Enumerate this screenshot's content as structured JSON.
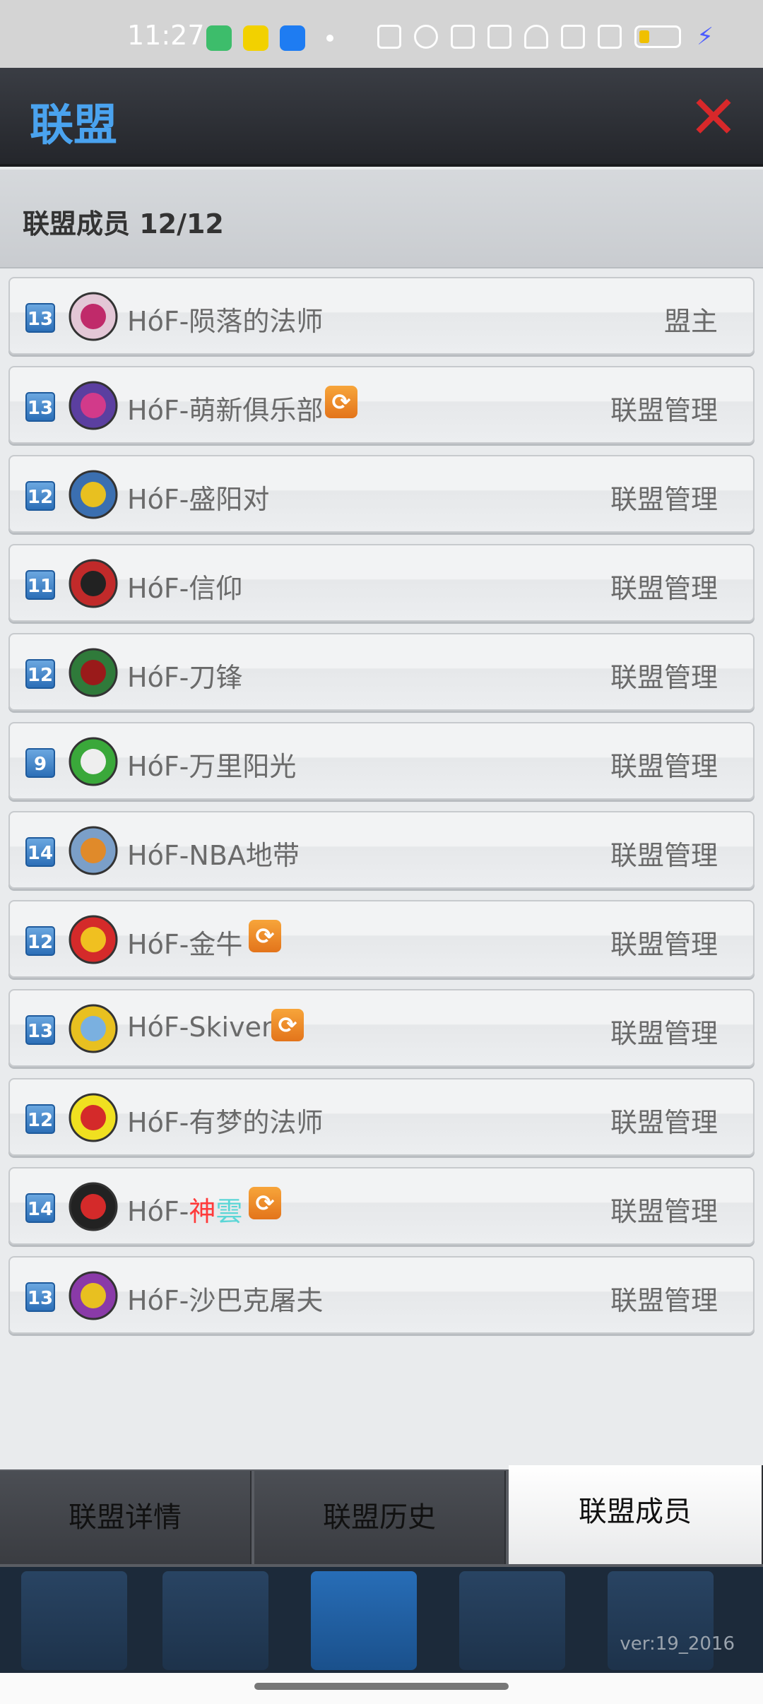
{
  "status": {
    "time": "11:27"
  },
  "header": {
    "title": "联盟"
  },
  "section": {
    "title": "联盟成员 12/12"
  },
  "members": [
    {
      "level": "13",
      "name": "HóF-陨落的法师",
      "role": "盟主",
      "swap": false
    },
    {
      "level": "13",
      "name": "HóF-萌新俱乐部",
      "role": "联盟管理",
      "swap": true
    },
    {
      "level": "12",
      "name": "HóF-盛阳对",
      "role": "联盟管理",
      "swap": false
    },
    {
      "level": "11",
      "name": "HóF-信仰",
      "role": "联盟管理",
      "swap": false
    },
    {
      "level": "12",
      "name": "HóF-刀锋",
      "role": "联盟管理",
      "swap": false
    },
    {
      "level": "9",
      "name": "HóF-万里阳光",
      "role": "联盟管理",
      "swap": false
    },
    {
      "level": "14",
      "name": "HóF-NBA地带",
      "role": "联盟管理",
      "swap": false
    },
    {
      "level": "12",
      "name": "HóF-金牛",
      "role": "联盟管理",
      "swap": true
    },
    {
      "level": "13",
      "name": "HóF-Skiven",
      "role": "联盟管理",
      "swap": true
    },
    {
      "level": "12",
      "name": "HóF-有梦的法师",
      "role": "联盟管理",
      "swap": false
    },
    {
      "level": "14",
      "name_prefix": "HóF-",
      "name_red": "神",
      "name_cyan": "雲",
      "role": "联盟管理",
      "swap": true
    },
    {
      "level": "13",
      "name": "HóF-沙巴克屠夫",
      "role": "联盟管理",
      "swap": false
    }
  ],
  "tabs": [
    {
      "label": "联盟详情"
    },
    {
      "label": "联盟历史"
    },
    {
      "label": "联盟成员"
    }
  ],
  "footer": {
    "version": "ver:19_2016"
  }
}
